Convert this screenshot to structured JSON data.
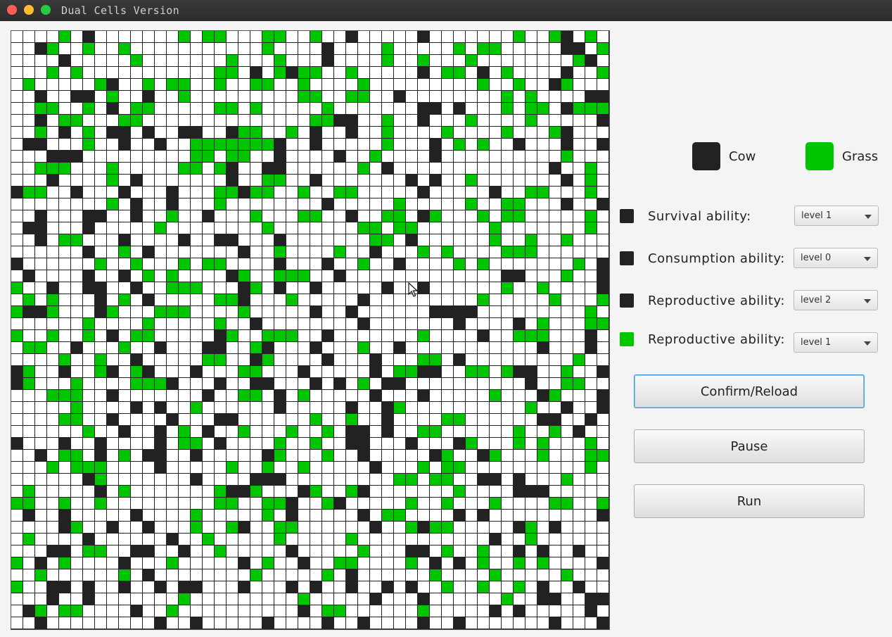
{
  "window": {
    "title": "Dual Cells Version"
  },
  "colors": {
    "cow": "#222222",
    "grass": "#00c600",
    "empty": "#ffffff"
  },
  "legend": {
    "cow_label": "Cow",
    "grass_label": "Grass"
  },
  "abilities": [
    {
      "swatch": "cow",
      "label": "Survival ability:",
      "value": "level 1"
    },
    {
      "swatch": "cow",
      "label": "Consumption ability:",
      "value": "level 0"
    },
    {
      "swatch": "cow",
      "label": "Reproductive ability:",
      "value": "level 2"
    },
    {
      "swatch": "grass",
      "label": "Reproductive ability:",
      "value": "level 1"
    }
  ],
  "buttons": {
    "confirm_label": "Confirm/Reload",
    "pause_label": "Pause",
    "run_label": "Run"
  },
  "grid": {
    "size": 50,
    "rows": [
      "....G.C.......G.GG...GG..G..C.....C.......G..GC.G...",
      "..CG..G..G...........G....C....G.....G.GG.....CC.G..",
      "....C.....G.......G...G...C....G..G...G........GC.C.",
      "...G.G...........GG.C.GCGG..G.....C.GG.C.G....C..G..",
      ".G.....GC..G.GG..G..GG..G....G.........G..G..CG...GC",
      "..C..CC.G..C..G.........GG..GG..C........G.G....CC..",
      "..GG..G.C.GG.....GG.G.....G.......CC.C...G.GG.CGGG..",
      "..C.GG...GG..............GGCC..G..C...G....G.....CC.",
      "..G.C.G.CC.C..CC..CGG..G.C..C..G....G....G...GC.....",
      ".CC...G..C..C..GGGGGGGC..C.....G...C.G.G..C...C..C..",
      "...CCC.........GG.GG..C....C..G....C..........G.....",
      "..GGG...G.....GG.GC..CC......G.C.............C..G..C.",
      "...C....G.C.......C..GG..C.......C.C..G.......C.G...",
      "CGG..C...C...C...GGCGG..G..GG.....C.....C..GG...G...",
      "........G.C..C...G........C.....G.....G..GG...C..CG.",
      "..C...CC..C..G..C...G...GG..C..GG.CG...G.GG.....G...",
      ".CC...C.....G........G.......GG.GG......G.......G..G",
      "..C.GG...C....C..CC...C.......GG.C......G..G..G....G",
      "......C..G.C.......C..G....G..C...G.G....GGG.......G",
      "C......G..G...G.GG....C...C..G..C....G.G.......G.CCC",
      ".C....C..C.G.G....CG..GGG..C.............CC...G..CC.",
      "G..C..CC..C..GGG...CG.C..C.....C..C......G..G....C.G",
      ".G.G...C.G.C.....GGC...G.....C.........G.....G...G.G",
      "GCCG...CG...GGG....G.....C..C......CCCC.........G..G",
      "......G....G.....G..C........C.......C....C.G...GG..",
      "G..G..G.C.GG.....CG..GGG..C.......G....C..GGG...C...",
      ".GG..C...G..C...CC..GC...C...G..C...........C...C...",
      "....G..G..C.....GG..CG....C...C...GG.C.........G..C",
      "CG..C..GC.GC...C...GG...C.....C.GGCC..GG.GCC..G..C.C",
      "CG...G....GGGC...C..CC...C.C.G.CC..........C..GG..C",
      "...GGG..C.......C..GG.C.G.....C...C.....G...CG...CC.",
      ".....G....C.C..G......C.....C..CG..........G..C..C.",
      "....GG..C....C...CC......G..G..C....GG......CC..C..",
      "......G..C..C.G.C..G...G..G.CC.C..GG......G..G.C....",
      "C...C..C....C.GG.C....G..G..CC...C...CG...G.G...G..",
      "..C.GG.C.G.CC..C.....CG...G..C.....CG..CG...G...GG.C",
      "...G.GGG....C.....G..G..G.....C...G.GG..........G...",
      "......CG.......C....CCC.........GG.GG..CC.C...G.....",
      ".G.....C.G.......GCCG...CG..GC.......G....CCC......C",
      "GG..G..G.........GG..GGC..GC.....G..G...G....GG..GGC",
      ".C..C.....C....G.....G.C.....C.GG....C.C.........CC.",
      "....CG..C..C...G..GC..GG......C..GCGG.....CG.C....CG",
      ".G....C......C..G.....G.....G...........C..G......GG",
      "...CC.GG..CC..C..G.....C.....G...CC.G..G..C.C..C...",
      "G.C.G....C...G.....C.G..C..GG....G.C.C.G..G.G....C.G",
      "..G......G.C........G.....G.C......G....G.....G......",
      "G..CC.C..C..C.CC...C...C.C..C..C.C..G..G..G.C..C...G",
      "...C..C.......G.........G.....C...C......G..CC..CC.C",
      ".CG.GG....C..G..........C.GG......G.....C.C.....C...",
      "..C.........C..C.....C....C..C....C..C.......C...CCC"
    ]
  }
}
